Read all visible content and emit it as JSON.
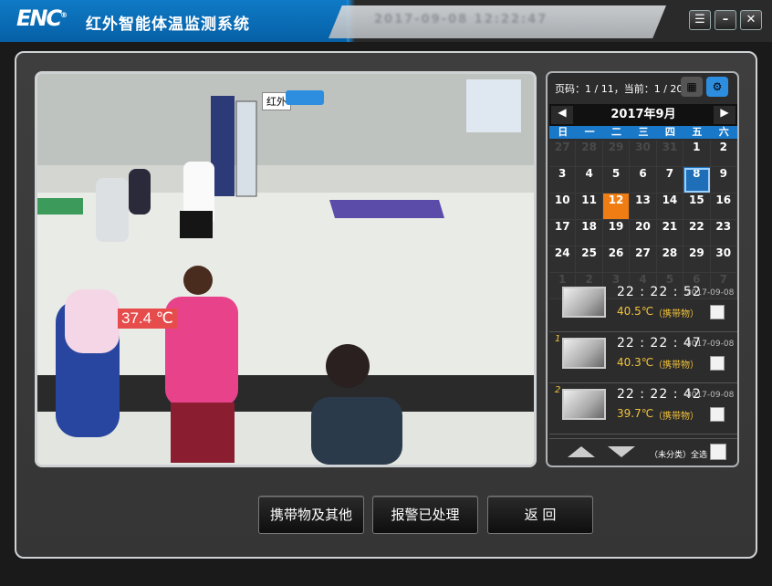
{
  "window": {
    "logo": "ENC",
    "title": "红外智能体温监测系统",
    "blurred_info": "2017-09-08 12:22:47"
  },
  "video": {
    "overlay_label": "红外",
    "temperature": "37.4 ℃"
  },
  "sidebar": {
    "page_info": "页码：1 / 11，当前：1 / 20",
    "month": "2017年9月",
    "weekdays": [
      "日",
      "一",
      "二",
      "三",
      "四",
      "五",
      "六"
    ],
    "days": [
      "27",
      "28",
      "29",
      "30",
      "31",
      "1",
      "2",
      "3",
      "4",
      "5",
      "6",
      "7",
      "8",
      "9",
      "10",
      "11",
      "12",
      "13",
      "14",
      "15",
      "16",
      "17",
      "18",
      "19",
      "20",
      "21",
      "22",
      "23",
      "24",
      "25",
      "26",
      "27",
      "28",
      "29",
      "30",
      "1",
      "2",
      "3",
      "4",
      "5",
      "6",
      "7"
    ],
    "records": [
      {
        "index": "",
        "time": "22 : 22 : 52",
        "date": "2017-09-08",
        "temp": "40.5℃",
        "tag": "（携带物）"
      },
      {
        "index": "1",
        "time": "22 : 22 : 47",
        "date": "2017-09-08",
        "temp": "40.3℃",
        "tag": "（携带物）"
      },
      {
        "index": "2",
        "time": "22 : 22 : 42",
        "date": "2017-09-08",
        "temp": "39.7℃",
        "tag": "（携带物）"
      }
    ],
    "select_all_label": "（未分类）全选"
  },
  "buttons": {
    "carry": "携带物及其他",
    "handled": "报警已处理",
    "back": "返 回"
  },
  "colors": {
    "accent_blue": "#1a78c8",
    "today_orange": "#ef7d14",
    "temp_red": "#e74c4c",
    "record_yellow": "#f3c33c"
  }
}
